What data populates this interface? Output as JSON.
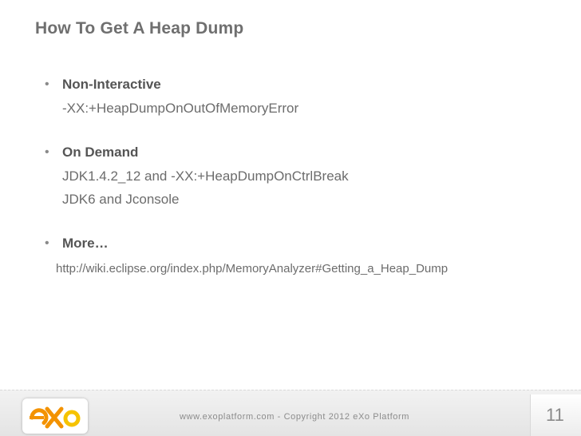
{
  "slide": {
    "title": "How To Get A Heap Dump",
    "bullet_glyph": "•",
    "items": [
      {
        "heading": "Non-Interactive",
        "lines": [
          "-XX:+HeapDumpOnOutOfMemoryError"
        ]
      },
      {
        "heading": "On Demand",
        "lines": [
          "JDK1.4.2_12 and -XX:+HeapDumpOnCtrlBreak",
          "JDK6 and Jconsole"
        ]
      },
      {
        "heading": "More…",
        "lines": [
          "http://wiki.eclipse.org/index.php/MemoryAnalyzer#Getting_a_Heap_Dump"
        ]
      }
    ]
  },
  "footer": {
    "logo_text": "eXo",
    "text": "www.exoplatform.com - Copyright 2012 eXo Platform",
    "page_number": "11"
  },
  "colors": {
    "logo_orange": "#f39200",
    "logo_yellow": "#f6c300",
    "text_gray": "#6c6c6c"
  },
  "icons": {
    "logo": "exo-logo"
  }
}
